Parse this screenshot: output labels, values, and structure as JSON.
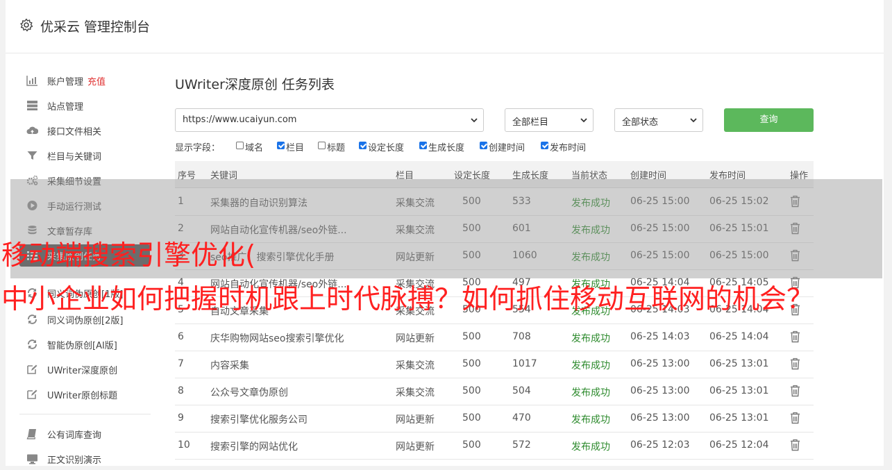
{
  "app": {
    "title": "优采云 管理控制台"
  },
  "sidebar": {
    "items": [
      {
        "label": "账户管理",
        "extra": "充值",
        "icon": "bar-chart-icon"
      },
      {
        "label": "站点管理",
        "icon": "server-icon"
      },
      {
        "label": "接口文件相关",
        "icon": "cloud-upload-icon"
      },
      {
        "label": "栏目与关键词",
        "icon": "filter-icon"
      },
      {
        "label": "采集细节设置",
        "icon": "cogs-icon"
      },
      {
        "label": "手动运行测试",
        "icon": "play-circle-icon"
      },
      {
        "label": "文章暂存库",
        "icon": "database-icon"
      },
      {
        "label": "采集原创任务",
        "icon": "list-icon",
        "active": true
      },
      {
        "label": "同义词伪原创[1版]",
        "icon": "refresh-icon"
      },
      {
        "label": "同义词伪原创[2版]",
        "icon": "refresh-icon"
      },
      {
        "label": "智能伪原创[AI版]",
        "icon": "refresh-icon"
      },
      {
        "label": "UWriter深度原创",
        "icon": "edit-icon"
      },
      {
        "label": "UWriter原创标题",
        "icon": "edit-icon"
      },
      {
        "label": "公有词库查询",
        "icon": "book-icon"
      },
      {
        "label": "正文识别演示",
        "icon": "monitor-icon"
      }
    ]
  },
  "main": {
    "title": "UWriter深度原创 任务列表",
    "site_select": "https://www.ucaiyun.com",
    "column_select": "全部栏目",
    "status_select": "全部状态",
    "query_button": "查询",
    "fields_label": "显示字段：",
    "fields": [
      {
        "label": "域名",
        "checked": false
      },
      {
        "label": "栏目",
        "checked": true
      },
      {
        "label": "标题",
        "checked": false
      },
      {
        "label": "设定长度",
        "checked": true
      },
      {
        "label": "生成长度",
        "checked": true
      },
      {
        "label": "创建时间",
        "checked": true
      },
      {
        "label": "发布时间",
        "checked": true
      }
    ],
    "table": {
      "headers": [
        "序号",
        "关键词",
        "栏目",
        "设定长度",
        "生成长度",
        "当前状态",
        "创建时间",
        "发布时间",
        "操作"
      ],
      "rows": [
        [
          "1",
          "采集器的自动识别算法",
          "采集交流",
          "500",
          "533",
          "发布成功",
          "06-25 15:00",
          "06-25 15:02"
        ],
        [
          "2",
          "网站自动化宣传机器/seo外链...",
          "采集交流",
          "500",
          "601",
          "发布成功",
          "06-25 15:00",
          "06-25 15:01"
        ],
        [
          "3",
          "seo推广：搜索引擎优化手册",
          "网站更新",
          "500",
          "1060",
          "发布成功",
          "06-25 15:00",
          "06-25 15:00"
        ],
        [
          "4",
          "网站自动化宣传机器/seo外链...",
          "采集交流",
          "500",
          "497",
          "发布成功",
          "06-25 14:04",
          "06-25 14:05"
        ],
        [
          "5",
          "自动文章采集",
          "采集交流",
          "500",
          "554",
          "发布成功",
          "06-25 14:03",
          "06-25 14:04"
        ],
        [
          "6",
          "庆华购物网站seo搜索引擎优化",
          "网站更新",
          "500",
          "708",
          "发布成功",
          "06-25 14:03",
          "06-25 14:04"
        ],
        [
          "7",
          "内容采集",
          "采集交流",
          "500",
          "1017",
          "发布成功",
          "06-25 13:00",
          "06-25 13:01"
        ],
        [
          "8",
          "公众号文章伪原创",
          "采集交流",
          "500",
          "504",
          "发布成功",
          "06-25 13:00",
          "06-25 13:01"
        ],
        [
          "9",
          "搜索引擎优化服务公司",
          "网站更新",
          "500",
          "470",
          "发布成功",
          "06-25 13:00",
          "06-25 13:01"
        ],
        [
          "10",
          "搜索引擎的网站优化",
          "网站更新",
          "500",
          "572",
          "发布成功",
          "06-25 12:03",
          "06-25 12:04"
        ]
      ]
    }
  },
  "overlay": {
    "line1": "移动端搜索引擎优化(",
    "line2": "中小企业如何把握时机跟上时代脉搏？如何抓住移动互联网的机会？"
  },
  "colors": {
    "accent_green": "#5cb85c",
    "status_green": "#2e8b2e",
    "overlay_red": "#ff2020",
    "active_bg": "#4a4a4a"
  }
}
